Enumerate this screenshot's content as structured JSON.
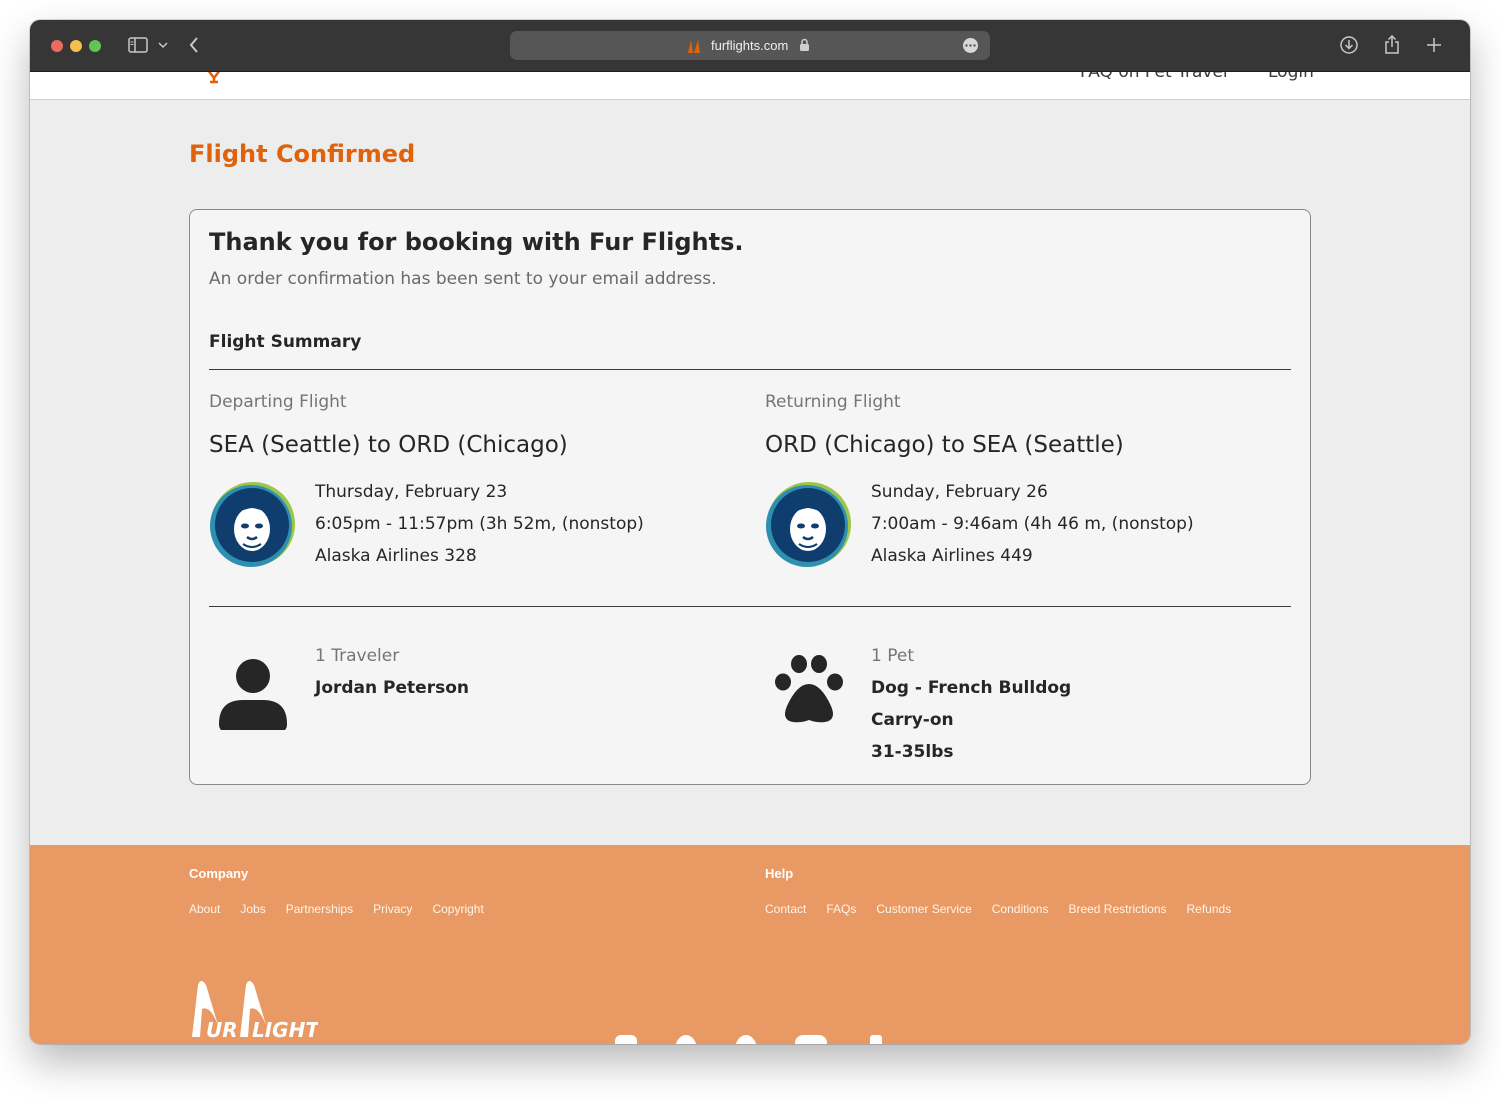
{
  "browser": {
    "url": "furflights.com",
    "icons": {
      "sidebar": "sidebar-icon",
      "back": "chevron-left-icon",
      "lock": "lock-icon",
      "more": "ellipsis-icon",
      "download": "download-icon",
      "share": "share-icon",
      "new_tab": "plus-icon"
    }
  },
  "header": {
    "nav": [
      "FAQ on Pet Travel",
      "Login"
    ]
  },
  "page": {
    "title": "Flight Confirmed",
    "accent_color": "#e0620b"
  },
  "confirmation": {
    "heading": "Thank you for booking with Fur Flights.",
    "subtext": "An order confirmation has been sent to your email address.",
    "summary_heading": "Flight Summary"
  },
  "flights": {
    "departing": {
      "label": "Departing Flight",
      "route": "SEA (Seattle) to ORD (Chicago)",
      "date": "Thursday, February 23",
      "time": "6:05pm - 11:57pm (3h 52m, (nonstop)",
      "flight": "Alaska Airlines 328"
    },
    "returning": {
      "label": "Returning Flight",
      "route": "ORD (Chicago) to SEA (Seattle)",
      "date": "Sunday, February 26",
      "time": "7:00am - 9:46am (4h 46 m, (nonstop)",
      "flight": "Alaska Airlines 449"
    }
  },
  "travelers": {
    "count": "1 Traveler",
    "name": "Jordan Peterson",
    "icon": "person-icon"
  },
  "pets": {
    "count": "1 Pet",
    "type": "Dog - French Bulldog",
    "carry": "Carry-on",
    "weight": "31-35lbs",
    "icon": "paw-icon"
  },
  "footer": {
    "background": "#e99a64",
    "company": {
      "title": "Company",
      "links": [
        "About",
        "Jobs",
        "Partnerships",
        "Privacy",
        "Copyright"
      ]
    },
    "help": {
      "title": "Help",
      "links": [
        "Contact",
        "FAQs",
        "Customer Service",
        "Conditions",
        "Breed Restrictions",
        "Refunds"
      ]
    },
    "logo_text": "Fur Flights"
  }
}
